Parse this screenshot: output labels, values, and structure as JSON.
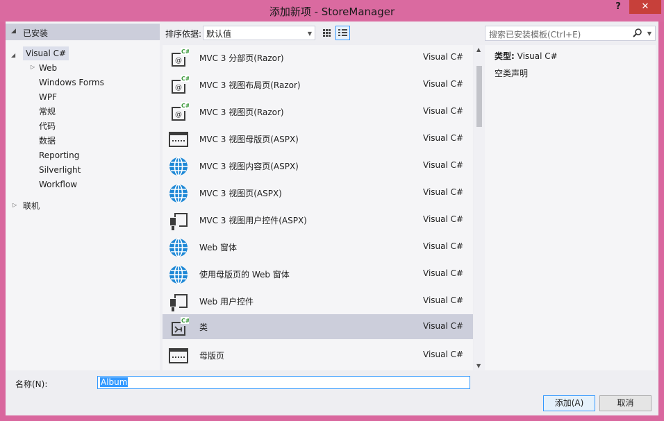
{
  "window": {
    "title": "添加新项 - StoreManager",
    "help": "?",
    "close": "✕"
  },
  "left": {
    "installed": "已安装",
    "items": [
      {
        "label": "Visual C#"
      },
      {
        "label": "Web"
      },
      {
        "label": "Windows Forms"
      },
      {
        "label": "WPF"
      },
      {
        "label": "常规"
      },
      {
        "label": "代码"
      },
      {
        "label": "数据"
      },
      {
        "label": "Reporting"
      },
      {
        "label": "Silverlight"
      },
      {
        "label": "Workflow"
      },
      {
        "label": "联机"
      }
    ]
  },
  "toolbar": {
    "sort_label": "排序依据:",
    "sort_value": "默认值"
  },
  "search": {
    "placeholder": "搜索已安装模板(Ctrl+E)"
  },
  "templates": [
    {
      "name": "MVC 3 分部页(Razor)",
      "lang": "Visual C#",
      "icon": "razor-cs-icon"
    },
    {
      "name": "MVC 3 视图布局页(Razor)",
      "lang": "Visual C#",
      "icon": "razor-cs-icon"
    },
    {
      "name": "MVC 3 视图页(Razor)",
      "lang": "Visual C#",
      "icon": "razor-cs-icon"
    },
    {
      "name": "MVC 3 视图母版页(ASPX)",
      "lang": "Visual C#",
      "icon": "master-page-icon"
    },
    {
      "name": "MVC 3 视图内容页(ASPX)",
      "lang": "Visual C#",
      "icon": "globe-icon"
    },
    {
      "name": "MVC 3 视图页(ASPX)",
      "lang": "Visual C#",
      "icon": "globe-icon"
    },
    {
      "name": "MVC 3 视图用户控件(ASPX)",
      "lang": "Visual C#",
      "icon": "user-control-icon"
    },
    {
      "name": "Web 窗体",
      "lang": "Visual C#",
      "icon": "globe-icon"
    },
    {
      "name": "使用母版页的 Web 窗体",
      "lang": "Visual C#",
      "icon": "globe-icon"
    },
    {
      "name": "Web 用户控件",
      "lang": "Visual C#",
      "icon": "user-control-icon"
    },
    {
      "name": "类",
      "lang": "Visual C#",
      "icon": "class-cs-icon",
      "selected": true
    },
    {
      "name": "母版页",
      "lang": "Visual C#",
      "icon": "master-page-icon"
    }
  ],
  "details": {
    "type_label": "类型:",
    "type_value": "Visual C#",
    "description": "空类声明"
  },
  "footer": {
    "name_label": "名称(N):",
    "name_value": "Album",
    "add_button": "添加(A)",
    "cancel_button": "取消"
  },
  "colors": {
    "frame": "#da6aa0",
    "close": "#c7403a",
    "selected_row": "#cccedb",
    "accent": "#3399ff",
    "icon_blue": "#1e88d6",
    "icon_green": "#3c9a3c"
  }
}
